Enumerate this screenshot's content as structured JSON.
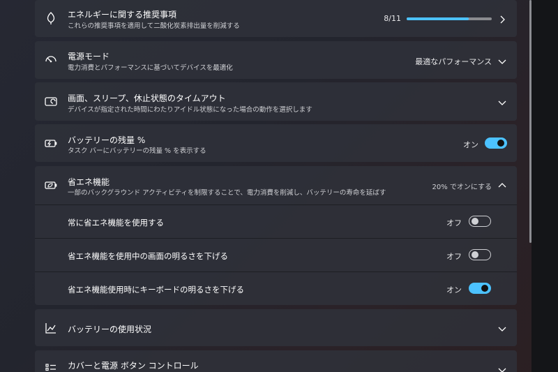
{
  "energy_recommendations": {
    "title": "エネルギーに関する推奨事項",
    "description": "これらの推奨事項を適用して二酸化炭素排出量を削減する",
    "progress_text": "8/11",
    "progress_fraction": 0.727
  },
  "power_mode": {
    "title": "電源モード",
    "description": "電力消費とパフォーマンスに基づいてデバイスを最適化",
    "value": "最適なパフォーマンス"
  },
  "screen_sleep": {
    "title": "画面、スリープ、休止状態のタイムアウト",
    "description": "デバイスが指定された時間にわたりアイドル状態になった場合の動作を選択します"
  },
  "battery_percentage": {
    "title": "バッテリーの残量 %",
    "description": "タスク バーにバッテリーの残量 % を表示する",
    "state_label": "オン"
  },
  "energy_saver": {
    "title": "省エネ機能",
    "description": "一部のバックグラウンド アクティビティを制限することで、電力消費を削減し、バッテリーの寿命を延ばす",
    "value": "20% でオンにする",
    "options": [
      {
        "label": "常に省エネ機能を使用する",
        "state_label": "オフ",
        "on": false
      },
      {
        "label": "省エネ機能を使用中の画面の明るさを下げる",
        "state_label": "オフ",
        "on": false
      },
      {
        "label": "省エネ機能使用時にキーボードの明るさを下げる",
        "state_label": "オン",
        "on": true
      }
    ]
  },
  "battery_usage": {
    "title": "バッテリーの使用状況"
  },
  "cover_power": {
    "title": "カバーと電源 ボタン コントロール"
  },
  "colors": {
    "accent": "#4cc2ff",
    "card": "#30323a"
  }
}
